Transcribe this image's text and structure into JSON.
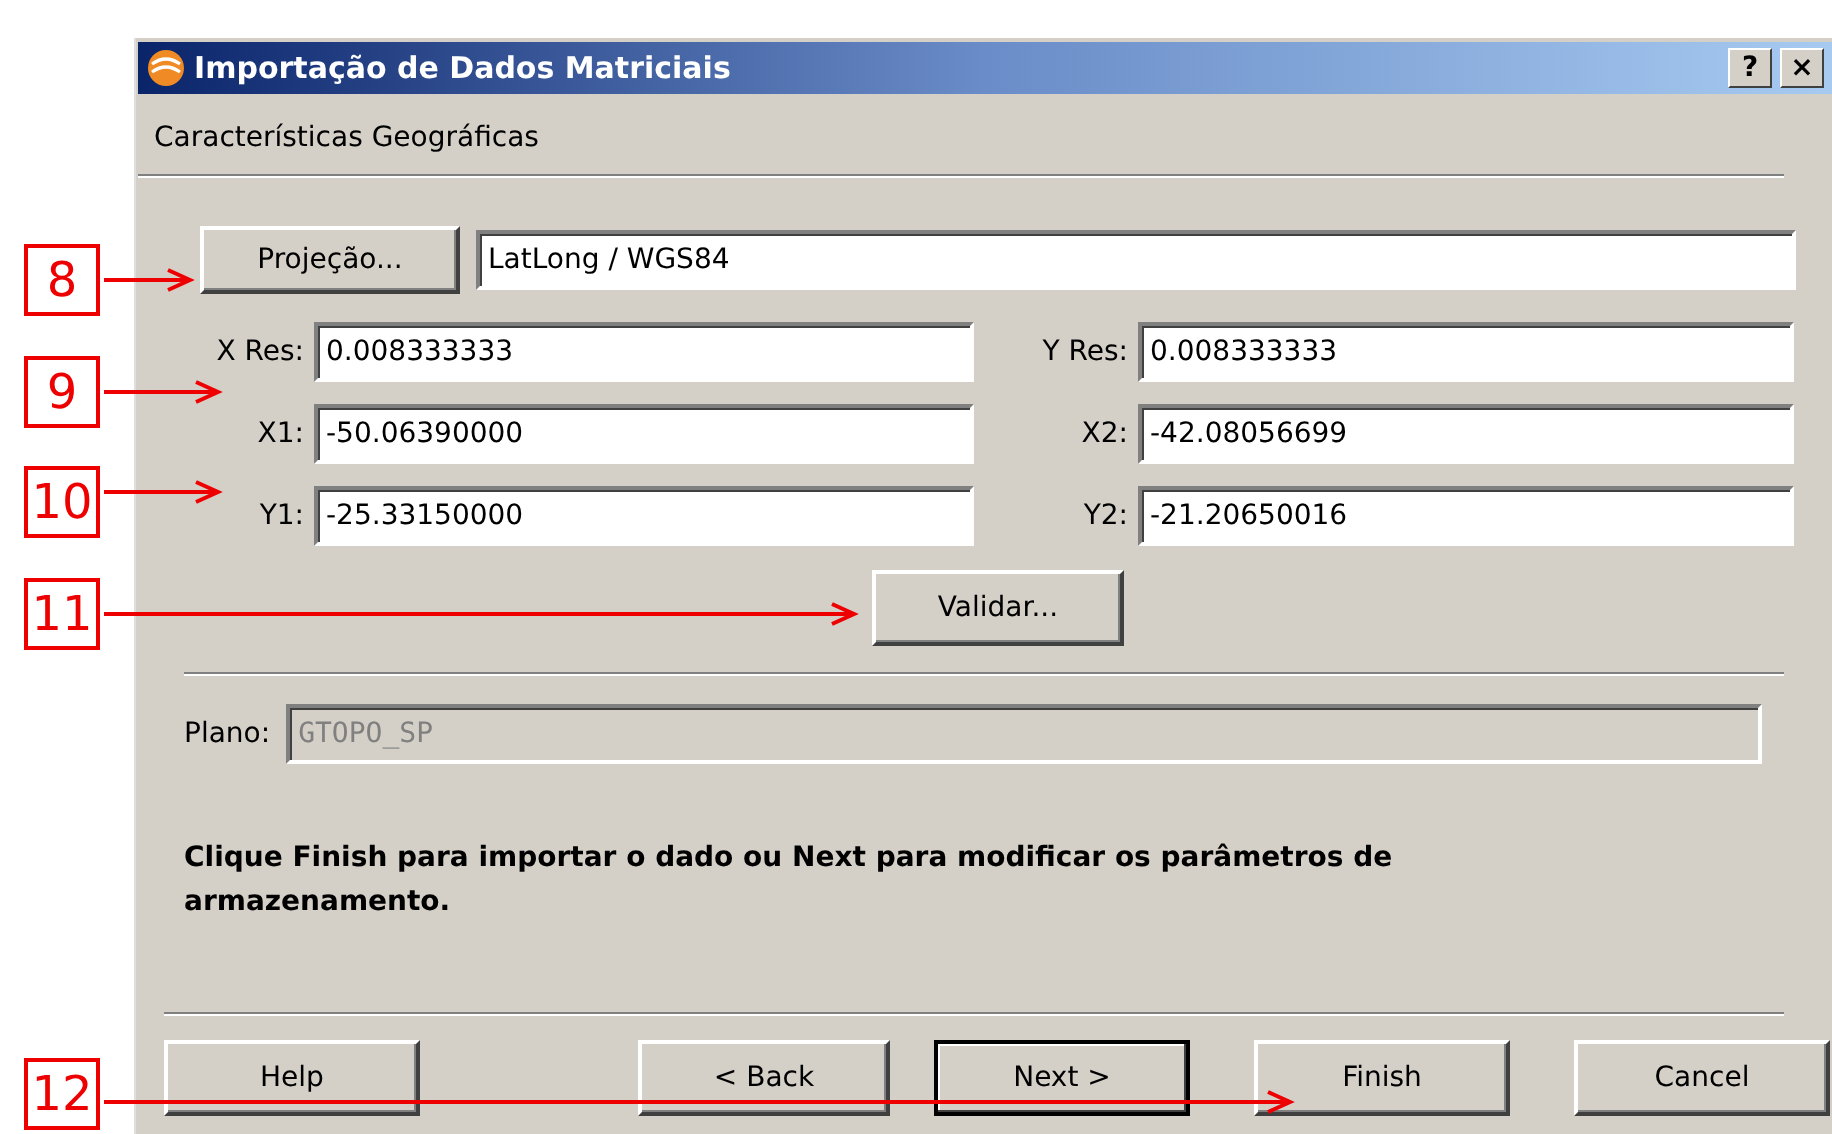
{
  "dialog": {
    "title": "Importação de Dados Matriciais",
    "help_button": "?",
    "close_button": "×",
    "subtitle": "Características Geográficas",
    "projection": {
      "button": "Projeção...",
      "value": "LatLong / WGS84"
    },
    "fields": [
      {
        "label": "X Res:",
        "value": "0.008333333"
      },
      {
        "label": "Y Res:",
        "value": "0.008333333"
      },
      {
        "label": "X1:",
        "value": "-50.06390000"
      },
      {
        "label": "X2:",
        "value": "-42.08056699"
      },
      {
        "label": "Y1:",
        "value": "-25.33150000"
      },
      {
        "label": "Y2:",
        "value": "-21.20650016"
      }
    ],
    "validate_button": "Validar...",
    "plane": {
      "label": "Plano:",
      "value": "GTOPO_SP",
      "disabled": true
    },
    "message": "Clique Finish para importar o dado ou Next para modificar os parâmetros de armazenamento.",
    "buttons": [
      {
        "label": "Help",
        "default": false
      },
      {
        "label": "< Back",
        "default": false
      },
      {
        "label": "Next >",
        "default": true
      },
      {
        "label": "Finish",
        "default": false
      },
      {
        "label": "Cancel",
        "default": false
      }
    ]
  },
  "callouts": [
    "8",
    "9",
    "10",
    "11",
    "12"
  ]
}
